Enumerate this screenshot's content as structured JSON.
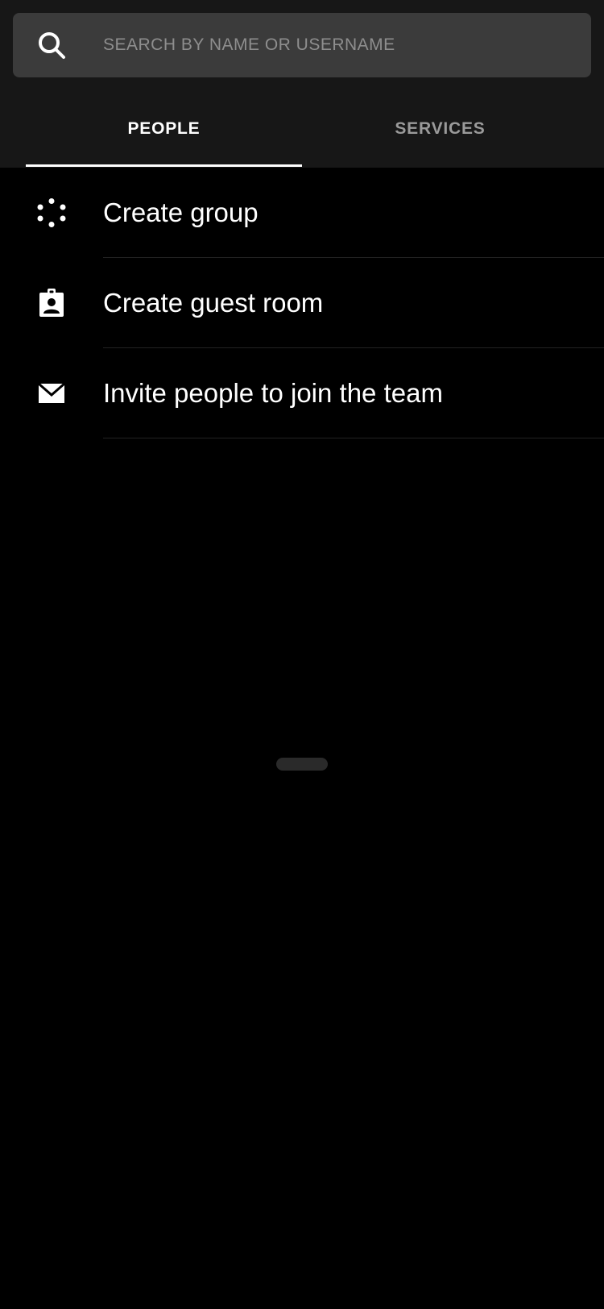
{
  "search": {
    "placeholder": "SEARCH BY NAME OR USERNAME",
    "icon": "search-icon"
  },
  "tabs": [
    {
      "label": "PEOPLE",
      "active": true
    },
    {
      "label": "SERVICES",
      "active": false
    }
  ],
  "actions": [
    {
      "label": "Create group",
      "icon": "group-icon"
    },
    {
      "label": "Create guest room",
      "icon": "badge-icon"
    },
    {
      "label": "Invite people to join the team",
      "icon": "envelope-icon"
    }
  ],
  "colors": {
    "background": "#000000",
    "header": "#171717",
    "search_field": "#3b3b3b",
    "active_tab": "#ffffff",
    "inactive_tab": "#9a9a9a",
    "placeholder": "#8e8e8e"
  }
}
